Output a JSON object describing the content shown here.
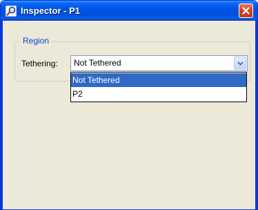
{
  "window": {
    "title": "Inspector - P1",
    "title_icon": "magnifier-icon",
    "close_icon": "close-icon"
  },
  "region": {
    "legend": "Region",
    "tethering_label": "Tethering:",
    "tethering_value": "Not Tethered",
    "dropdown_icon": "chevron-down-icon",
    "options": [
      {
        "label": "Not Tethered",
        "selected": true
      },
      {
        "label": "P2",
        "selected": false
      }
    ]
  },
  "colors": {
    "titlebar": "#0053e1",
    "selection": "#316ac5",
    "legend_text": "#0046d5",
    "close_button": "#d9431d"
  }
}
